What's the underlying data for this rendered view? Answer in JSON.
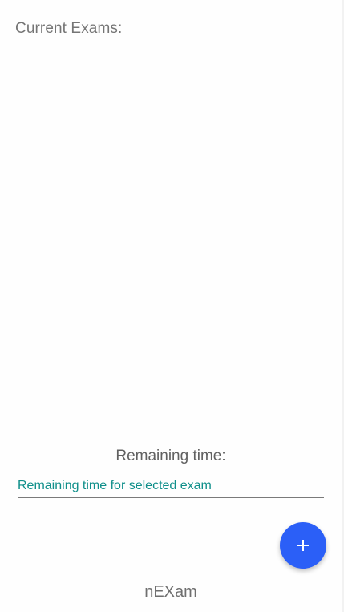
{
  "header": {
    "label": "Current Exams:"
  },
  "exams": [],
  "remaining": {
    "title": "Remaining time:",
    "field_value": "Remaining time for selected exam"
  },
  "fab": {
    "icon": "plus-icon"
  },
  "footer": {
    "app_name": "nEXam"
  },
  "colors": {
    "accent_text": "#0f8f8a",
    "fab_background": "#2b5ff7"
  }
}
